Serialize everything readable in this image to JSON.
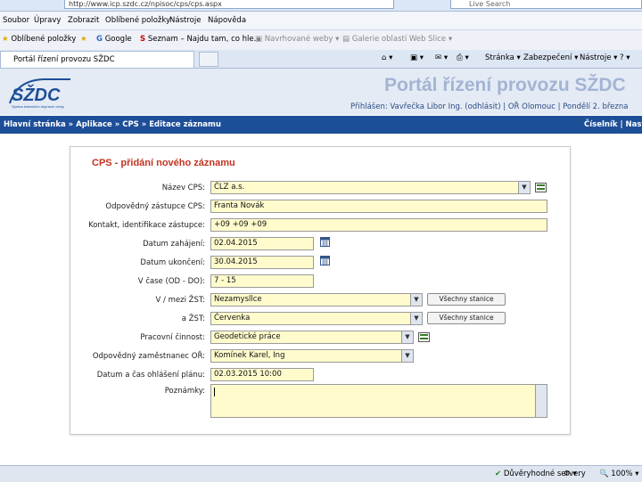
{
  "browser": {
    "url": "http://www.icp.szdc.cz/npisoc/cps/cps.aspx",
    "search_placeholder": "Live Search",
    "menu": [
      "Soubor",
      "Úpravy",
      "Zobrazit",
      "Oblíbené položky",
      "Nástroje",
      "Nápověda"
    ],
    "favorites": {
      "favorites_button": "Oblíbené položky",
      "google": "Google",
      "seznam": "Seznam – Najdu tam, co hle...",
      "suggested_sites": "Navrhované weby",
      "web_slice": "Galerie oblastí Web Slice"
    },
    "tab_title": "Portál řízení provozu SŽDC",
    "commands": [
      "Stránka",
      "Zabezpečení",
      "Nástroje"
    ],
    "status": "Důvěryhodné servery",
    "zoom": "100%"
  },
  "header": {
    "logo_text": "SŽDC",
    "logo_subtitle": "Správa železniční dopravní cesty",
    "portal_title": "Portál řízení provozu SŽDC",
    "user_line": "Přihlášen: Vavřečka Libor Ing. (odhlásit) | OŘ Olomouc | Pondělí 2. března"
  },
  "nav": {
    "breadcrumb": "Hlavní stránka » Aplikace » CPS » Editace záznamu",
    "right": "Číselník | Nast"
  },
  "form": {
    "title": "CPS - přidání nového záznamu",
    "fields": {
      "nazev_cps": {
        "label": "Název CPS:",
        "value": "ČLZ a.s."
      },
      "zastupce": {
        "label": "Odpovědný zástupce CPS:",
        "value": "Franta Novák"
      },
      "kontakt": {
        "label": "Kontakt, identifikace zástupce:",
        "value": "+09 +09 +09"
      },
      "datum_zahajeni": {
        "label": "Datum zahájení:",
        "value": "02.04.2015"
      },
      "datum_ukonceni": {
        "label": "Datum ukončení:",
        "value": "30.04.2015"
      },
      "cas": {
        "label": "V čase (OD - DO):",
        "value": "7 - 15"
      },
      "v_mezi_zst": {
        "label": "V / mezi ŽST:",
        "value": "Nezamysllce"
      },
      "a_zst": {
        "label": "a ŽST:",
        "value": "Červenka"
      },
      "pracovni_cinnost": {
        "label": "Pracovní činnost:",
        "value": "Geodetické práce"
      },
      "zamestnanec": {
        "label": "Odpovědný zaměstnanec OŘ:",
        "value": "Komínek Karel, Ing"
      },
      "datum_ohlaseni": {
        "label": "Datum a čas ohlášení plánu:",
        "value": "02.03.2015 10:00"
      },
      "poznamky": {
        "label": "Poznámky:",
        "value": ""
      }
    },
    "btn_all_stations": "Všechny stanice"
  },
  "colors": {
    "nav_bg": "#1d4e98",
    "title_red": "#c0331f",
    "input_yellow": "#fffbcc",
    "header_bg": "#e4ebf5"
  }
}
